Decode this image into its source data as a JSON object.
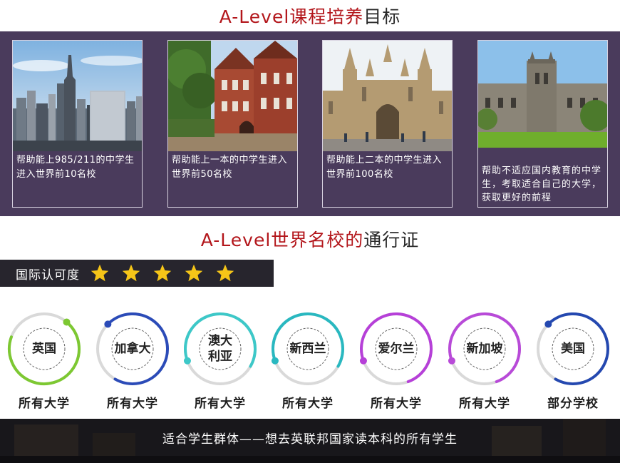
{
  "section1": {
    "title_red": "A-Level课程培养",
    "title_dark": "目标",
    "cards": [
      {
        "caption": "帮助能上985/211的中学生进入世界前10名校"
      },
      {
        "caption": "帮助能上一本的中学生进入世界前50名校"
      },
      {
        "caption": "帮助能上二本的中学生进入世界前100名校"
      },
      {
        "caption": "帮助不适应国内教育的中学生，考取适合自己的大学，获取更好的前程"
      }
    ]
  },
  "section2": {
    "title_red": "A-Level世界名校的",
    "title_dark": "通行证"
  },
  "recognition": {
    "label": "国际认可度",
    "stars": 5,
    "star_color": "#f5c518"
  },
  "countries": [
    {
      "name": "英国",
      "desc": "所有大学",
      "color": "#7dc832"
    },
    {
      "name": "加拿大",
      "desc": "所有大学",
      "color": "#2b4bb8"
    },
    {
      "name": "澳大利亚",
      "desc": "所有大学",
      "color": "#3dc8c8"
    },
    {
      "name": "新西兰",
      "desc": "所有大学",
      "color": "#29b8c0"
    },
    {
      "name": "爱尔兰",
      "desc": "所有大学",
      "color": "#b640d8"
    },
    {
      "name": "新加坡",
      "desc": "所有大学",
      "color": "#b84ad8"
    },
    {
      "name": "美国",
      "desc": "部分学校",
      "color": "#2448b0"
    }
  ],
  "footer": {
    "text": "适合学生群体——想去英联邦国家读本科的所有学生"
  }
}
